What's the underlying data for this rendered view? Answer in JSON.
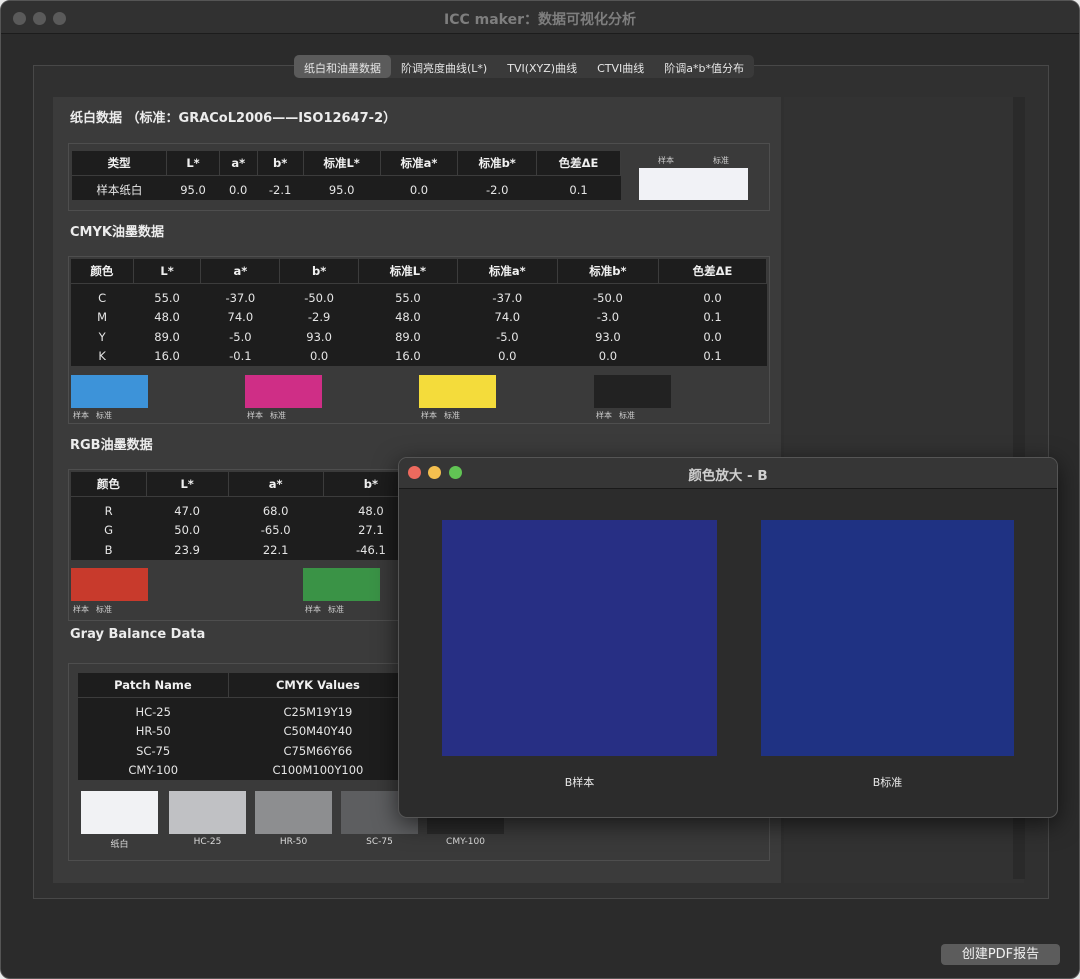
{
  "window": {
    "title": "ICC maker：数据可视化分析"
  },
  "tabs": [
    "纸白和油墨数据",
    "阶调亮度曲线(L*)",
    "TVI(XYZ)曲线",
    "CTVI曲线",
    "阶调a*b*值分布"
  ],
  "paper": {
    "heading": "纸白数据  （标准：GRACoL2006——ISO12647-2）",
    "headers": [
      "类型",
      "L*",
      "a*",
      "b*",
      "标准L*",
      "标准a*",
      "标准b*",
      "色差ΔE"
    ],
    "row": [
      "样本纸白",
      "95.0",
      "0.0",
      "-2.1",
      "95.0",
      "0.0",
      "-2.0",
      "0.1"
    ],
    "swatch_labels": [
      "样本",
      "标准"
    ],
    "swatch_color": "#f1f2f6"
  },
  "cmyk": {
    "heading": "CMYK油墨数据",
    "headers": [
      "颜色",
      "L*",
      "a*",
      "b*",
      "标准L*",
      "标准a*",
      "标准b*",
      "色差ΔE"
    ],
    "rows": [
      [
        "C",
        "55.0",
        "-37.0",
        "-50.0",
        "55.0",
        "-37.0",
        "-50.0",
        "0.0"
      ],
      [
        "M",
        "48.0",
        "74.0",
        "-2.9",
        "48.0",
        "74.0",
        "-3.0",
        "0.1"
      ],
      [
        "Y",
        "89.0",
        "-5.0",
        "93.0",
        "89.0",
        "-5.0",
        "93.0",
        "0.0"
      ],
      [
        "K",
        "16.0",
        "-0.1",
        "0.0",
        "16.0",
        "0.0",
        "0.0",
        "0.1"
      ]
    ],
    "swatches": [
      {
        "color": "#3d93d9",
        "sample": "样本",
        "standard": "标准"
      },
      {
        "color": "#cf2e86",
        "sample": "样本",
        "standard": "标准"
      },
      {
        "color": "#f4dc3b",
        "sample": "样本",
        "standard": "标准"
      },
      {
        "color": "#222222",
        "sample": "样本",
        "standard": "标准"
      }
    ]
  },
  "rgb": {
    "heading": "RGB油墨数据",
    "headers": [
      "颜色",
      "L*",
      "a*",
      "b*"
    ],
    "rows": [
      [
        "R",
        "47.0",
        "68.0",
        "48.0"
      ],
      [
        "G",
        "50.0",
        "-65.0",
        "27.1"
      ],
      [
        "B",
        "23.9",
        "22.1",
        "-46.1"
      ]
    ],
    "swatches": [
      {
        "color": "#c83a2c",
        "sample": "样本",
        "standard": "标准"
      },
      {
        "color": "#3a9346",
        "sample": "样本",
        "standard": "标准"
      }
    ]
  },
  "gray": {
    "heading": "Gray Balance Data",
    "headers": [
      "Patch Name",
      "CMYK Values"
    ],
    "rows": [
      [
        "HC-25",
        "C25M19Y19"
      ],
      [
        "HR-50",
        "C50M40Y40"
      ],
      [
        "SC-75",
        "C75M66Y66"
      ],
      [
        "CMY-100",
        "C100M100Y100"
      ]
    ],
    "swatches": [
      {
        "label": "纸白",
        "color": "#f1f2f4"
      },
      {
        "label": "HC-25",
        "color": "#c0c1c4"
      },
      {
        "label": "HR-50",
        "color": "#8d8e90"
      },
      {
        "label": "SC-75",
        "color": "#5d5e60"
      },
      {
        "label": "CMY-100",
        "color": "#2a2a2a"
      }
    ]
  },
  "pdf_button": "创建PDF报告",
  "popup": {
    "title": "颜色放大 - B",
    "sample_label": "B样本",
    "standard_label": "B标准",
    "sample_color": "#272f84",
    "standard_color": "#1f3283"
  }
}
